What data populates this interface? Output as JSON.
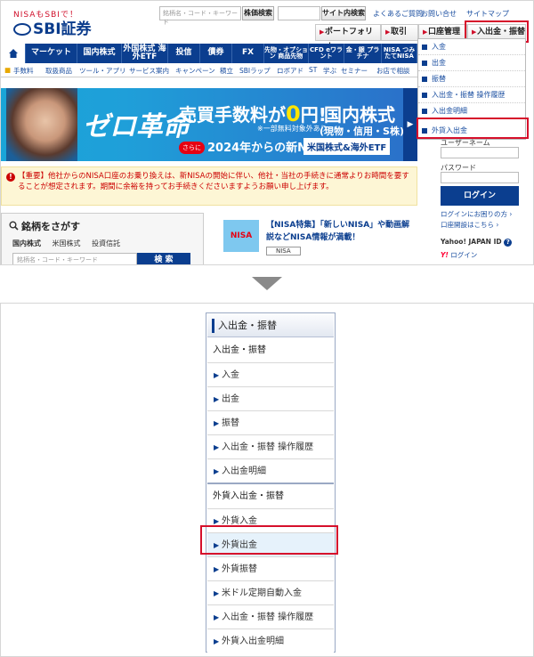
{
  "header": {
    "logo_tagline": "NISAもSBIで！",
    "logo_name": "SBI証券",
    "stock_search_placeholder": "銘柄名・コード・キーワード",
    "stock_search_button": "株価検索",
    "site_search_button": "サイト内検索",
    "links": [
      "よくあるご質問",
      "お問い合せ",
      "サイトマップ"
    ],
    "tabs": [
      "ポートフォリオ",
      "取引",
      "口座管理",
      "入出金・振替"
    ]
  },
  "nav": {
    "home_icon": "home-icon",
    "items": [
      "マーケット",
      "国内株式",
      "外国株式 海外ETF",
      "投信",
      "債券",
      "FX",
      "先物・オプション 商品先物",
      "CFD eワラント",
      "金・銀 プラチナ",
      "NISA つみたてNISA"
    ],
    "new_badge": "NEW",
    "sub_items": [
      "手数料",
      "取扱商品",
      "ツール・アプリ",
      "サービス案内",
      "キャンペーン",
      "積立",
      "SBIラップ",
      "ロボアド",
      "ST",
      "学ぶ",
      "セミナー",
      "お店で相談"
    ]
  },
  "banner": {
    "headline": "ゼロ革命",
    "fee_prefix": "売買手数料が",
    "fee_value": "0",
    "fee_suffix": "円!",
    "domestic": "国内株式",
    "note": "※一部無料対象外あり",
    "physical": "(現物・信用・S株)",
    "pill": "さらに",
    "nisa": "2024年からの新NISA",
    "box": "米国株式&海外ETF"
  },
  "notice": {
    "text": "【重要】他社からのNISA口座のお乗り換えは、新NISAの開始に伴い、他社・当社の手続きに通常よりお時間を要することが想定されます。期間に余裕を持ってお手続きくださいますようお願い申し上げます。"
  },
  "search": {
    "title": "銘柄をさがす",
    "tabs": [
      "国内株式",
      "米国株式",
      "投資信託"
    ],
    "placeholder": "銘柄名・コード・キーワード",
    "button": "検 索"
  },
  "promo": {
    "image_label": "NISA",
    "text": "【NISA特集】「新しいNISA」や動画解説などNISA情報が満載！",
    "tag": "NISA"
  },
  "dropdown": {
    "items": [
      "入金",
      "出金",
      "振替",
      "入出金・振替 操作履歴",
      "入出金明細",
      "外貨入出金"
    ]
  },
  "login": {
    "username_label": "ユーザーネーム",
    "password_label": "パスワード",
    "button": "ログイン",
    "trouble_link": "ログインにお困りの方",
    "open_account_link": "口座開設はこちら",
    "yahoo_label": "Yahoo! JAPAN ID",
    "yahoo_logo": "Y!",
    "yahoo_login": "ログイン"
  },
  "menu": {
    "header": "入出金・振替",
    "group1_title": "入出金・振替",
    "group1_items": [
      "入金",
      "出金",
      "振替",
      "入出金・振替 操作履歴",
      "入出金明細"
    ],
    "group2_title": "外貨入出金・振替",
    "group2_items": [
      "外貨入金",
      "外貨出金",
      "外貨振替",
      "米ドル定期自動入金",
      "入出金・振替 操作履歴",
      "外貨入出金明細"
    ]
  },
  "colors": {
    "brand_navy": "#0b3e8f",
    "highlight_red": "#d6102b",
    "notice_bg": "#fdf6d5"
  }
}
